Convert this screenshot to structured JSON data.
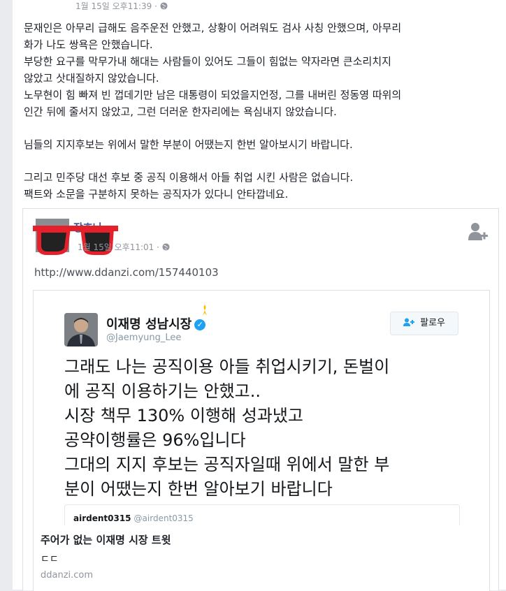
{
  "post": {
    "timestamp": "1월 15일 오후11:39 · ",
    "lines": [
      "문재인은 아무리 급해도 음주운전 안했고, 상황이 어려워도 검사 사칭 안했으며, 아무리",
      "화가 나도 쌍욕은 안했습니다.",
      "부당한 요구를 막무가내 해대는 사람들이 있어도 그들이 힘없는 약자라면 큰소리치지",
      "않았고 삿대질하지 않았습니다.",
      "노무현이 힘 빠져 빈 껍데기만 남은 대통령이 되었을지언정, 그를 내버린 정동영 따위의",
      "인간 뒤에 줄서지 않았고, 그런 더러운 한자리에는 욕심내지 않았습니다.",
      "",
      "님들의 지지후보는 위에서 말한 부분이 어땠는지 한번 알아보시기 바랍니다.",
      "",
      "그리고 민주당 대선 후보 중 공직 이용해서 아들 취업 시킨 사람은 없습니다.",
      "팩트와 소문을 구분하지 못하는 공직자가 있다니 안타깝네요."
    ]
  },
  "shared": {
    "author": "장효나",
    "timestamp": "1월 15일 오후11:01 · ",
    "link": "http://www.ddanzi.com/157440103",
    "tweet": {
      "name": "이재명 성남시장",
      "verified_mark": "✓",
      "handle": "@Jaemyung_Lee",
      "follow_label": "팔로우",
      "lines": [
        "그래도 나는 공직이용 아들 취업시키기, 돈벌이",
        "에 공직 이용하기는 안했고..",
        "시장 책무 130% 이행해 성과냈고",
        "공약이행률은 96%입니다",
        "그대의 지지 후보는 공직자일때 위에서 말한 부",
        "분이 어땠는지 한번 알아보기 바랍니다"
      ],
      "quote_user": "airdent0315",
      "quote_handle": "@airdent0315"
    },
    "card": {
      "title": "주어가 없는 이재명 시장 트윗",
      "desc": "ㄷㄷ",
      "domain": "ddanzi.com"
    }
  },
  "colors": {
    "link_blue": "#365899",
    "twitter_blue": "#1da1f2",
    "sunglasses_red": "#e5202a"
  },
  "icons": [
    "globe-icon",
    "add-friend-icon",
    "sunglasses-sticker",
    "verified-badge-icon",
    "follow-person-icon",
    "yellow-ribbon-icon"
  ]
}
